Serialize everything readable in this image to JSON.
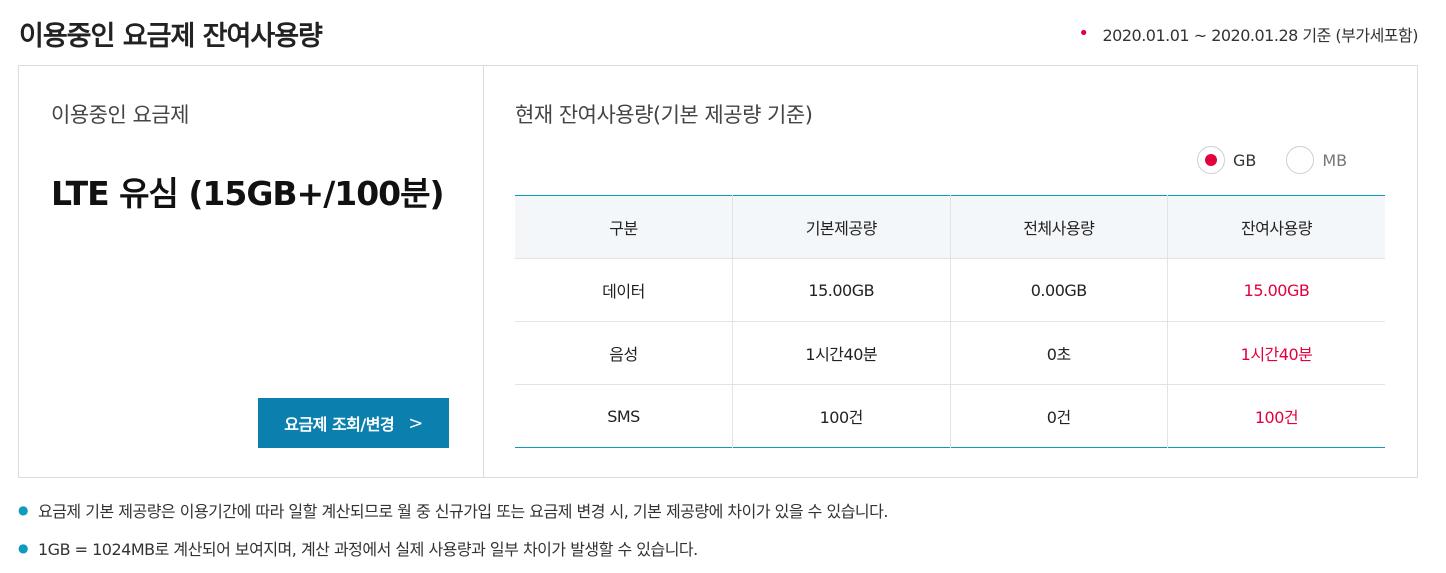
{
  "header": {
    "title": "이용중인 요금제 잔여사용량",
    "period": "2020.01.01 ~ 2020.01.28 기준 (부가세포함)"
  },
  "plan": {
    "label": "이용중인 요금제",
    "name": "LTE 유심 (15GB+/100분)",
    "button_label": "요금제 조회/변경",
    "button_icon": "chevron-right-icon"
  },
  "usage": {
    "label": "현재 잔여사용량(기본 제공량 기준)",
    "units": [
      {
        "label": "GB",
        "selected": true
      },
      {
        "label": "MB",
        "selected": false
      }
    ],
    "columns": [
      "구분",
      "기본제공량",
      "전체사용량",
      "잔여사용량"
    ],
    "rows": [
      {
        "type": "데이터",
        "base": "15.00GB",
        "used": "0.00GB",
        "remain": "15.00GB"
      },
      {
        "type": "음성",
        "base": "1시간40분",
        "used": "0초",
        "remain": "1시간40분"
      },
      {
        "type": "SMS",
        "base": "100건",
        "used": "0건",
        "remain": "100건"
      }
    ],
    "accent_color": "#e4003f"
  },
  "notes": [
    "요금제 기본 제공량은 이용기간에 따라 일할 계산되므로 월 중 신규가입 또는 요금제 변경 시, 기본 제공량에 차이가 있을 수 있습니다.",
    "1GB = 1024MB로 계산되어 보여지며, 계산 과정에서 실제 사용량과 일부 차이가 발생할 수 있습니다."
  ]
}
